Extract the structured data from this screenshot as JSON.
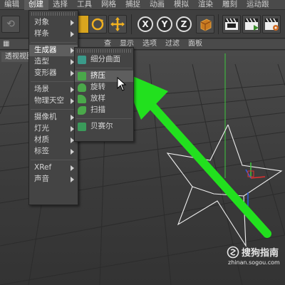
{
  "menubar": {
    "items": [
      "编辑",
      "创建",
      "选择",
      "工具",
      "网格",
      "捕捉",
      "动画",
      "模拟",
      "渲染",
      "雕刻",
      "运动跟"
    ],
    "active_index": 1
  },
  "toolbar": {
    "axis_labels": [
      "X",
      "Y",
      "Z"
    ]
  },
  "viewport_header": {
    "items": [
      "查",
      "显示",
      "选项",
      "过滤",
      "面板"
    ],
    "view_label": "透视视图"
  },
  "create_menu": {
    "items": [
      {
        "label": "对象",
        "submenu": true
      },
      {
        "label": "样条",
        "submenu": true
      },
      {
        "label": "生成器",
        "submenu": true
      },
      {
        "label": "造型",
        "submenu": true
      },
      {
        "label": "变形器",
        "submenu": true
      },
      {
        "label": "场景",
        "submenu": true
      },
      {
        "label": "物理天空",
        "submenu": true
      },
      {
        "label": "摄像机",
        "submenu": true
      },
      {
        "label": "灯光",
        "submenu": true
      },
      {
        "label": "材质",
        "submenu": true
      },
      {
        "label": "标签",
        "submenu": true
      },
      {
        "label": "XRef",
        "submenu": true
      },
      {
        "label": "声音",
        "submenu": true
      }
    ]
  },
  "generator_submenu": {
    "items": [
      {
        "label": "细分曲面",
        "icon": "subdivision-surface-icon"
      },
      {
        "label": "挤压",
        "icon": "extrude-icon"
      },
      {
        "label": "旋转",
        "icon": "lathe-icon"
      },
      {
        "label": "放样",
        "icon": "loft-icon"
      },
      {
        "label": "扫描",
        "icon": "sweep-icon"
      },
      {
        "label": "贝赛尔",
        "icon": "bezier-icon"
      }
    ],
    "highlighted": "挤压"
  },
  "watermark": {
    "brand": "搜狗指南",
    "url": "zhinan.sogou.com"
  },
  "colors": {
    "arrow": "#22e01e",
    "axis_y": "#3ec83e",
    "axis_x": "#e03030",
    "axis_z": "#3060e0"
  }
}
